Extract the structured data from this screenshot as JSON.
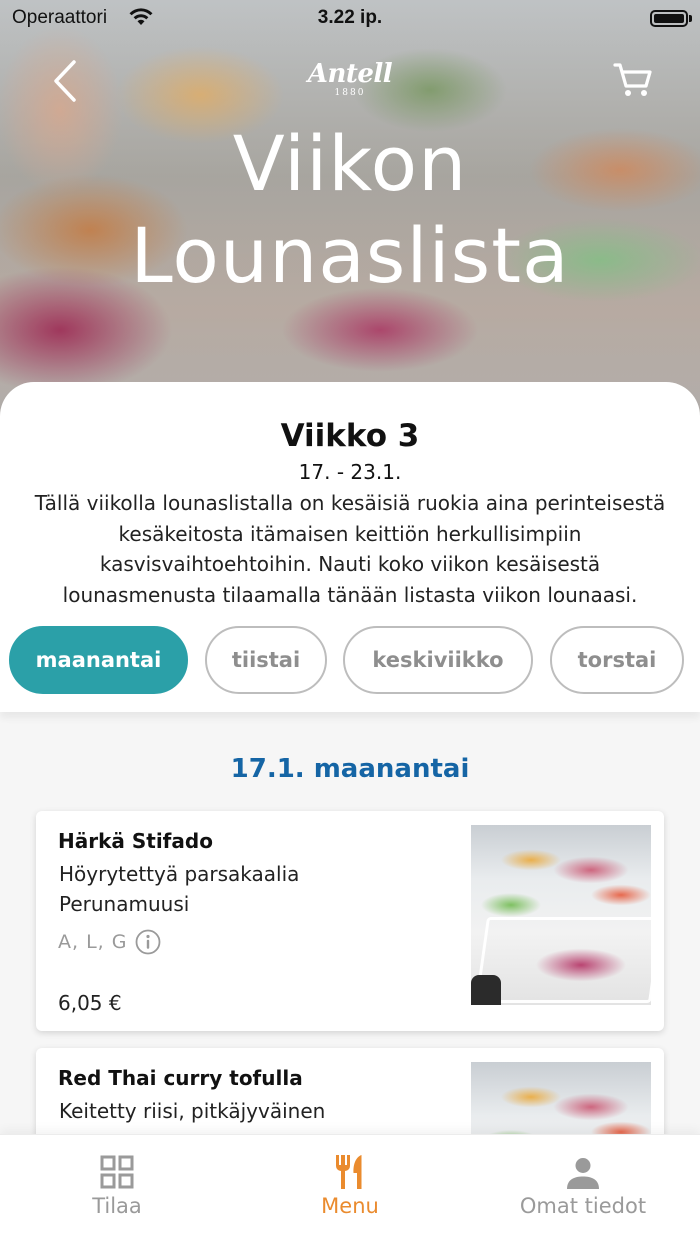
{
  "status_bar": {
    "carrier": "Operaattori",
    "time": "3.22 ip."
  },
  "header": {
    "brand": "Antell",
    "brand_year": "1880",
    "title_line1": "Viikon",
    "title_line2": "Lounaslista",
    "back_icon": "chevron-left-icon",
    "cart_icon": "cart-icon"
  },
  "week": {
    "title": "Viikko 3",
    "dates": "17. - 23.1.",
    "description": "Tällä viikolla lounaslistalla on kesäisiä ruokia aina perinteisestä kesäkeitosta itämaisen keittiön herkullisimpiin kasvisvaihtoehtoihin. Nauti koko viikon kesäisestä lounasmenusta tilaamalla tänään listasta viikon lounaasi."
  },
  "day_tabs": [
    {
      "label": "maanantai",
      "active": true
    },
    {
      "label": "tiistai",
      "active": false
    },
    {
      "label": "keskiviikko",
      "active": false
    },
    {
      "label": "torstai",
      "active": false
    }
  ],
  "menu": {
    "date_heading": "17.1. maanantai",
    "items": [
      {
        "name": "Härkä Stifado",
        "lines": [
          "Höyrytettyä parsakaalia",
          "Perunamuusi"
        ],
        "allergens": "A, L, G",
        "price": "6,05 €"
      },
      {
        "name": "Red Thai curry tofulla",
        "lines": [
          "Keitetty riisi, pitkäjyväinen"
        ]
      }
    ]
  },
  "tab_bar": [
    {
      "label": "Tilaa",
      "icon": "grid-icon",
      "active": false
    },
    {
      "label": "Menu",
      "icon": "fork-knife-icon",
      "active": true
    },
    {
      "label": "Omat tiedot",
      "icon": "user-icon",
      "active": false
    }
  ],
  "colors": {
    "accent_teal": "#2ba0a8",
    "heading_blue": "#1565a5",
    "active_orange": "#ea8b2e"
  }
}
